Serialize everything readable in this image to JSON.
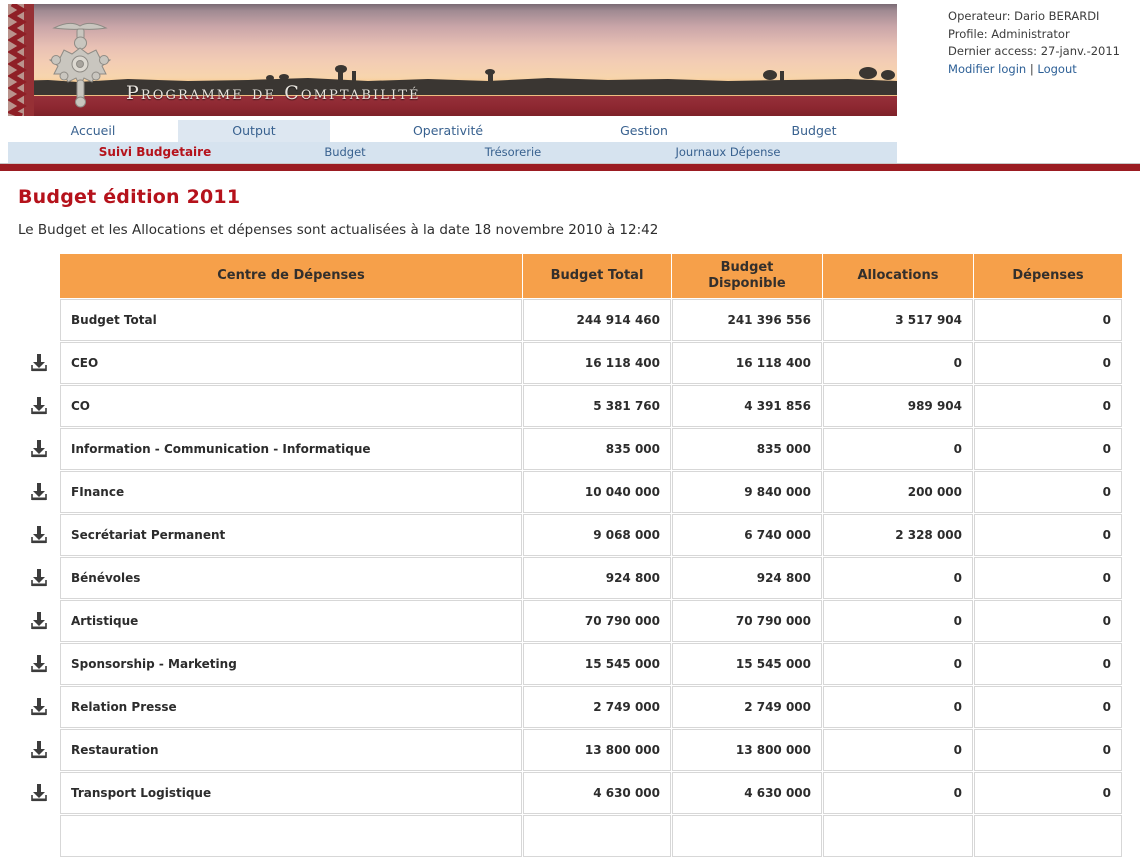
{
  "banner": {
    "title": "Programme de Comptabilité",
    "emblem_icon": "tuareg-cross-emblem",
    "zigzag_icon": "zigzag-border-decoration"
  },
  "user": {
    "operator_label": "Operateur: Dario BERARDI",
    "profile_label": "Profile: Administrator",
    "last_access_label": "Dernier access: 27-janv.-2011",
    "modify_login_link": "Modifier login",
    "separator": "|",
    "logout_link": "Logout"
  },
  "nav": {
    "main_tabs": [
      {
        "label": "Accueil",
        "active": false
      },
      {
        "label": "Output",
        "active": true
      },
      {
        "label": "Operativité",
        "active": false
      },
      {
        "label": "Gestion",
        "active": false
      },
      {
        "label": "Budget",
        "active": false
      }
    ],
    "sub_tabs": [
      {
        "label": "Suivi Budgetaire",
        "active": true
      },
      {
        "label": "Budget",
        "active": false
      },
      {
        "label": "Trésorerie",
        "active": false
      },
      {
        "label": "Journaux Dépense",
        "active": false
      }
    ]
  },
  "page": {
    "title": "Budget édition 2011",
    "subtitle": "Le Budget et les Allocations et dépenses sont actualisées à la date 18 novembre 2010 à 12:42"
  },
  "table": {
    "columns": [
      "Centre de Dépenses",
      "Budget Total",
      "Budget Disponible",
      "Allocations",
      "Dépenses"
    ],
    "total_row": {
      "name": "Budget Total",
      "budget_total": "244 914 460",
      "budget_disponible": "241 396 556",
      "allocations": "3 517 904",
      "depenses": "0"
    },
    "download_icon": "download-icon",
    "rows": [
      {
        "name": "CEO",
        "budget_total": "16 118 400",
        "budget_disponible": "16 118 400",
        "allocations": "0",
        "depenses": "0"
      },
      {
        "name": "CO",
        "budget_total": "5 381 760",
        "budget_disponible": "4 391 856",
        "allocations": "989 904",
        "depenses": "0"
      },
      {
        "name": "Information - Communication - Informatique",
        "budget_total": "835 000",
        "budget_disponible": "835 000",
        "allocations": "0",
        "depenses": "0"
      },
      {
        "name": "FInance",
        "budget_total": "10 040 000",
        "budget_disponible": "9 840 000",
        "allocations": "200 000",
        "depenses": "0"
      },
      {
        "name": "Secrétariat Permanent",
        "budget_total": "9 068 000",
        "budget_disponible": "6 740 000",
        "allocations": "2 328 000",
        "depenses": "0"
      },
      {
        "name": "Bénévoles",
        "budget_total": "924 800",
        "budget_disponible": "924 800",
        "allocations": "0",
        "depenses": "0"
      },
      {
        "name": "Artistique",
        "budget_total": "70 790 000",
        "budget_disponible": "70 790 000",
        "allocations": "0",
        "depenses": "0"
      },
      {
        "name": "Sponsorship - Marketing",
        "budget_total": "15 545 000",
        "budget_disponible": "15 545 000",
        "allocations": "0",
        "depenses": "0"
      },
      {
        "name": "Relation Presse",
        "budget_total": "2 749 000",
        "budget_disponible": "2 749 000",
        "allocations": "0",
        "depenses": "0"
      },
      {
        "name": "Restauration",
        "budget_total": "13 800 000",
        "budget_disponible": "13 800 000",
        "allocations": "0",
        "depenses": "0"
      },
      {
        "name": "Transport Logistique",
        "budget_total": "4 630 000",
        "budget_disponible": "4 630 000",
        "allocations": "0",
        "depenses": "0"
      }
    ]
  },
  "colors": {
    "accent_red": "#b5121b",
    "header_orange": "#f6a04a",
    "nav_blue": "#38618f",
    "subnav_bg": "#d6e3ef"
  }
}
